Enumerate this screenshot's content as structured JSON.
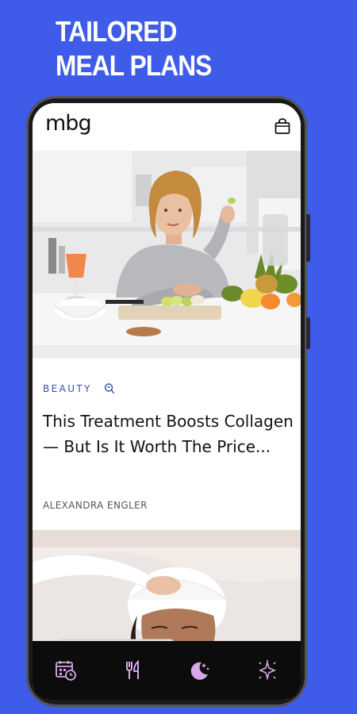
{
  "promo": {
    "line1": "TAILORED",
    "line2": "MEAL PLANS"
  },
  "app": {
    "logo": "mbg"
  },
  "topbar": {
    "cart_icon": "shopping-bag-icon"
  },
  "article1": {
    "category": "BEAUTY",
    "category_icon": "headphone-icon",
    "title_line1": "This Treatment Boosts Collagen",
    "title_line2": "— But Is It Worth The Price...",
    "author": "ALEXANDRA ENGLER"
  },
  "nav": {
    "items": [
      {
        "icon": "calendar-clock-icon"
      },
      {
        "icon": "fork-knife-icon"
      },
      {
        "icon": "moon-stars-icon"
      },
      {
        "icon": "sparkle-icon"
      }
    ],
    "icon_color": "#d9a6e8"
  },
  "colors": {
    "background": "#3f5bea",
    "category": "#3a4da8"
  }
}
